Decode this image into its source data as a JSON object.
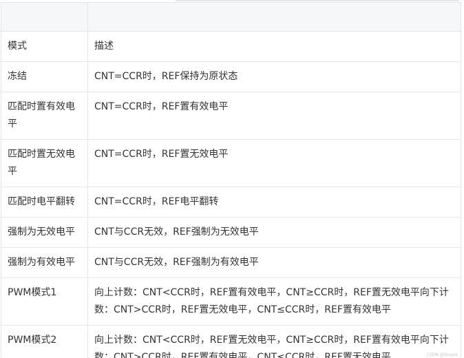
{
  "table": {
    "header": [
      "",
      ""
    ],
    "rows": [
      {
        "mode": "模式",
        "description": "描述"
      },
      {
        "mode": "冻结",
        "description": "CNT=CCR时，REF保持为原状态"
      },
      {
        "mode": "匹配时置有效电平",
        "description": "CNT=CCR时，REF置有效电平"
      },
      {
        "mode": "匹配时置无效电平",
        "description": "CNT=CCR时，REF置无效电平"
      },
      {
        "mode": "匹配时电平翻转",
        "description": "CNT=CCR时，REF电平翻转"
      },
      {
        "mode": "强制为无效电平",
        "description": "CNT与CCR无效，REF强制为无效电平"
      },
      {
        "mode": "强制为有效电平",
        "description": "CNT与CCR无效，REF强制为有效电平"
      },
      {
        "mode": "PWM模式1",
        "description": "向上计数：CNT<CCR时，REF置有效电平，CNT≥CCR时，REF置无效电平向下计数：CNT>CCR时，REF置无效电平，CNT≤CCR时，REF置有效电平"
      },
      {
        "mode": "PWM模式2",
        "description": "向上计数：CNT<CCR时，REF置无效电平，CNT≥CCR时，REF置有效电平向下计数：CNT>CCR时，REF置有效电平，CNT≤CCR时，REF置无效电平"
      }
    ]
  },
  "watermark": "CSDN @Stayes"
}
